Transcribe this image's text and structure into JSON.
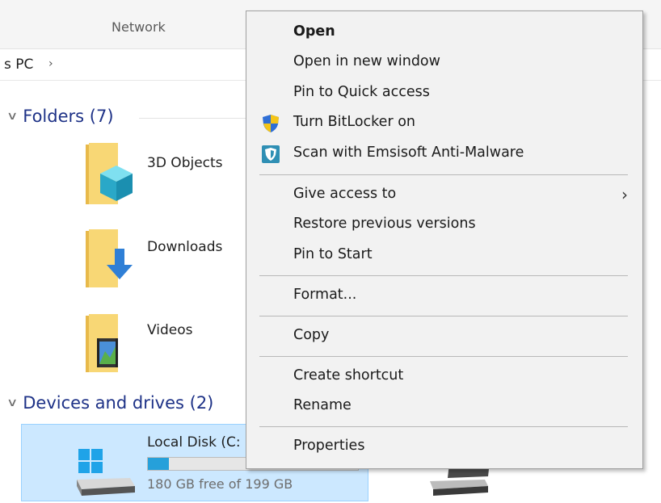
{
  "explorer": {
    "tab": "Network",
    "breadcrumb": "s PC",
    "breadcrumb_sep": "›",
    "folders_group": "Folders (7)",
    "folders": [
      {
        "label": "3D Objects",
        "icon": "3d-objects-folder-icon"
      },
      {
        "label": "Downloads",
        "icon": "downloads-folder-icon"
      },
      {
        "label": "Videos",
        "icon": "videos-folder-icon"
      }
    ],
    "devices_group": "Devices and drives (2)",
    "drive": {
      "name": "Local Disk (C:",
      "free": "180 GB free of 199 GB",
      "used_fraction": 0.1
    }
  },
  "menu": {
    "items": [
      {
        "label": "Open"
      },
      {
        "label": "Open in new window"
      },
      {
        "label": "Pin to Quick access"
      },
      {
        "label": "Turn BitLocker on",
        "icon": "uac-shield-icon"
      },
      {
        "label": "Scan with Emsisoft Anti-Malware",
        "icon": "emsisoft-shield-icon"
      },
      {
        "label": "Give access to",
        "submenu_arrow": "›"
      },
      {
        "label": "Restore previous versions"
      },
      {
        "label": "Pin to Start"
      },
      {
        "label": "Format..."
      },
      {
        "label": "Copy"
      },
      {
        "label": "Create shortcut"
      },
      {
        "label": "Rename"
      },
      {
        "label": "Properties"
      }
    ]
  },
  "colors": {
    "menu_bg": "#f2f2f2",
    "selection_bg": "#cce8ff",
    "group_header": "#1e3287",
    "progress_fill": "#26a0da"
  }
}
